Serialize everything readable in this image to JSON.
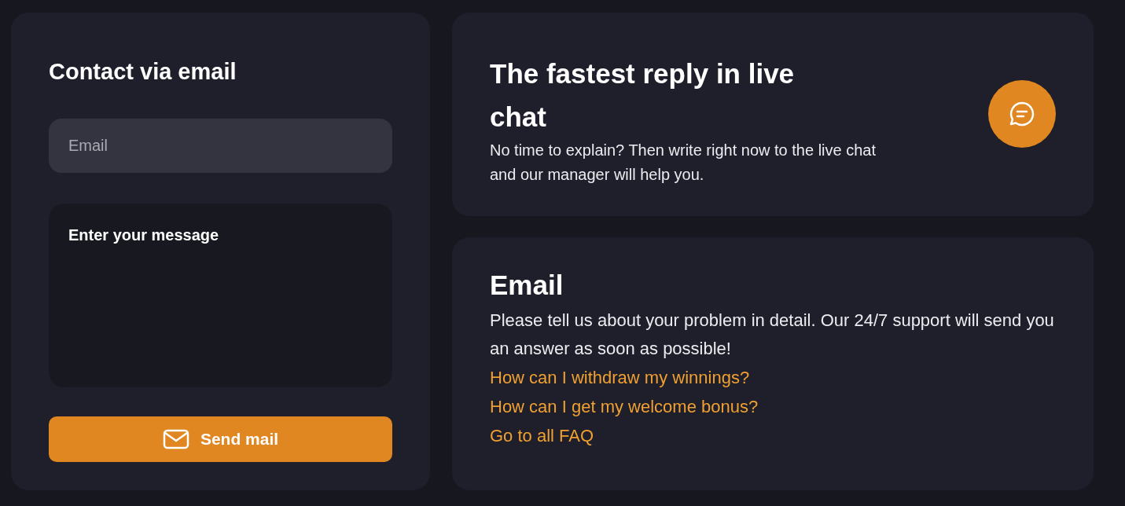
{
  "contact_form": {
    "title": "Contact via email",
    "email_field": {
      "placeholder": "Email"
    },
    "message_field": {
      "placeholder": "Enter your message"
    },
    "send_button": {
      "label": "Send mail"
    }
  },
  "live_chat": {
    "title": "The fastest reply in live chat",
    "text": "No time to explain? Then write right now to the live chat and our manager will help you."
  },
  "email_info": {
    "title": "Email",
    "text": "Please tell us about your problem in detail. Our 24/7 support will send you an answer as soon as possible!",
    "links": [
      "How can I withdraw my winnings?",
      "How can I get my welcome bonus?",
      "Go to all FAQ"
    ]
  }
}
